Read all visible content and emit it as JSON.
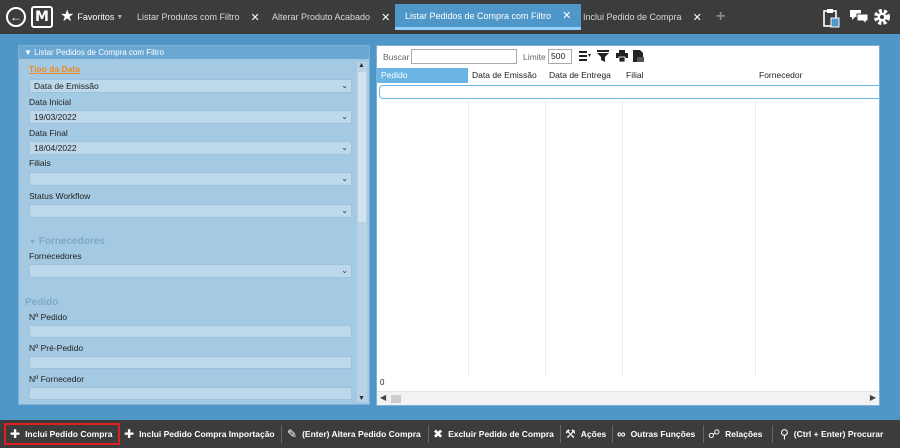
{
  "topbar": {
    "back_icon": "circle-arrow-left-icon",
    "logo_letter": "M",
    "favorites_label": "Favoritos",
    "tabs": [
      {
        "label": "Listar Produtos com Filtro",
        "active": false
      },
      {
        "label": "Alterar Produto Acabado",
        "active": false
      },
      {
        "label": "Listar Pedidos de Compra com Filtro",
        "active": true
      },
      {
        "label": "Inclui Pedido de Compra",
        "active": false
      }
    ],
    "close_glyph": "✕",
    "add_tab_glyph": "+",
    "right_icons": [
      "clipboard-badge-icon",
      "chat-bubbles-icon",
      "gear-icon"
    ]
  },
  "filter_panel": {
    "title": "Listar Pedidos de Compra com Filtro",
    "tipo_data_label": "Tipo da Data",
    "tipo_data_value": "Data de Emissão",
    "data_inicial_label": "Data Inicial",
    "data_inicial_value": "19/03/2022",
    "data_final_label": "Data Final",
    "data_final_value": "18/04/2022",
    "filiais_label": "Filiais",
    "status_label": "Status Workflow",
    "fornecedores_section": "Fornecedores",
    "fornecedores_label": "Fornecedores",
    "pedido_section": "Pedido",
    "num_pedido_label": "Nº Pedido",
    "num_prepedido_label": "Nº Pré-Pedido",
    "num_fornecedor_label": "Nº Fornecedor"
  },
  "results": {
    "search_label": "Buscar",
    "search_value": "",
    "limit_label": "Limite",
    "limit_value": "500",
    "columns": [
      "Pedido",
      "Data de Emissão",
      "Data de Entrega",
      "Filial",
      "Fornecedor"
    ],
    "active_column": "Pedido",
    "row_count": "0",
    "toolbar_icons": [
      "list-sort-icon",
      "filter-funnel-icon",
      "print-icon",
      "export-document-icon"
    ]
  },
  "bottombar": {
    "buttons": [
      {
        "label": "Inclui Pedido Compra",
        "icon": "plus-icon",
        "highlighted": true
      },
      {
        "label": "Inclui Pedido Compra Importação",
        "icon": "plus-icon",
        "highlighted": false
      },
      {
        "label": "(Enter) Altera Pedido Compra",
        "icon": "pencil-icon",
        "highlighted": false
      },
      {
        "label": "Excluir Pedido de Compra",
        "icon": "x-icon",
        "highlighted": false
      },
      {
        "label": "Ações",
        "icon": "hammer-icon",
        "highlighted": false
      },
      {
        "label": "Outras Funções",
        "icon": "link-icon",
        "highlighted": false
      },
      {
        "label": "Relações",
        "icon": "network-icon",
        "highlighted": false
      },
      {
        "label": "(Ctrl + Enter) Procurar",
        "icon": "magnifier-icon",
        "highlighted": false
      }
    ]
  },
  "colors": {
    "topbar": "#3c3c3c",
    "workspace": "#4f96c9",
    "filter_panel": "#a4c9e2",
    "accent_orange": "#f08a1c",
    "highlight_red": "#e02020",
    "grid_active_header": "#6ab5e3"
  }
}
